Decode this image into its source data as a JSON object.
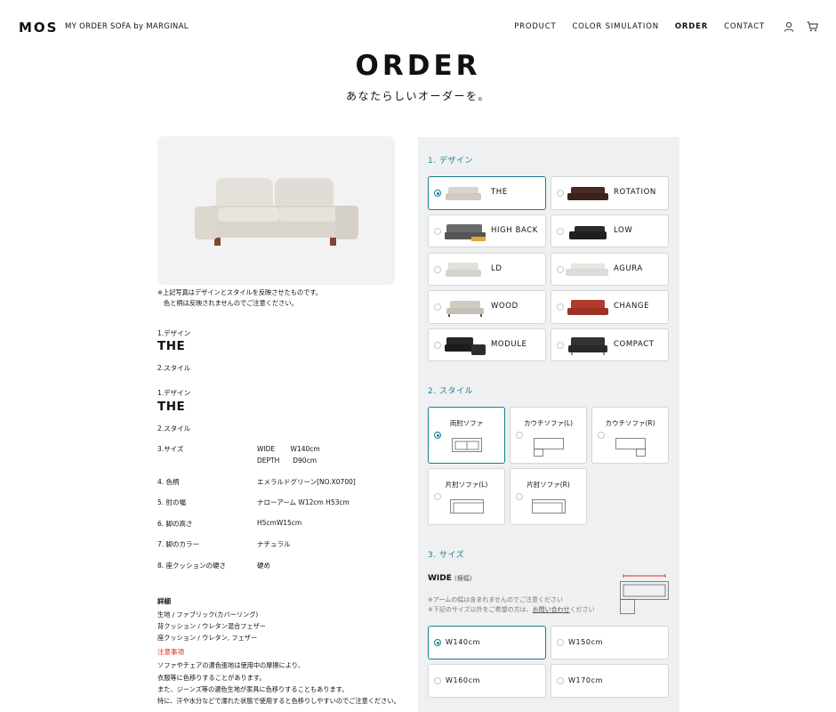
{
  "header": {
    "logo": "MOS",
    "tagline": "MY ORDER SOFA by MARGINAL",
    "nav": [
      {
        "label": "PRODUCT",
        "active": false
      },
      {
        "label": "COLOR SIMULATION",
        "active": false
      },
      {
        "label": "ORDER",
        "active": true
      },
      {
        "label": "CONTACT",
        "active": false
      }
    ],
    "icons": [
      "user-icon",
      "cart-icon"
    ]
  },
  "page": {
    "title": "ORDER",
    "subtitle": "あなたらしいオーダーを。"
  },
  "left": {
    "photo_note": [
      "※上記写真はデザインとスタイルを反映させたものです。",
      "色と柄は反映されませんのでご注意ください。"
    ],
    "summary_a": {
      "design_label": "1.デザイン",
      "design_value": "THE",
      "style_label": "2.スタイル"
    },
    "summary_b": {
      "design_label": "1.デザイン",
      "design_value": "THE",
      "style_label": "2.スタイル"
    },
    "specs": [
      {
        "label": "3.サイズ",
        "value": "WIDE　　 W140cm",
        "value2": "DEPTH　　D90cm"
      },
      {
        "label": "4. 色柄",
        "value": "エメラルドグリーン[NO.X0700]"
      },
      {
        "label": "5. 肘の幅",
        "value": "ナローアーム W12cm H53cm"
      },
      {
        "label": "6. 脚の高さ",
        "value": "H5cmW15cm"
      },
      {
        "label": "7. 脚のカラー",
        "value": "ナチュラル"
      },
      {
        "label": "8. 座クッションの硬さ",
        "value": "硬め"
      }
    ],
    "details_title": "詳細",
    "details": [
      "生地 / ファブリック(カバーリング)",
      "背クッション / ウレタン混合フェザー",
      "座クッション / ウレタン, フェザー"
    ],
    "caution_title": "注意事項",
    "caution": [
      "ソファやチェアの濃色張地は使用中の摩擦により、",
      "衣服等に色移りすることがあります。",
      "また、ジーンズ等の濃色生地が家具に色移りすることもあります。",
      "特に、汗や水分などで濡れた状態で使用すると色移りしやすいのでご注意ください。"
    ]
  },
  "design": {
    "title": "1. デザイン",
    "options": [
      {
        "label": "THE",
        "selected": true,
        "color": "#d9d5ce"
      },
      {
        "label": "ROTATION",
        "selected": false,
        "color": "#4a2a24"
      },
      {
        "label": "HIGH BACK",
        "selected": false,
        "color": "#6a6a6a"
      },
      {
        "label": "LOW",
        "selected": false,
        "color": "#2a2a2a"
      },
      {
        "label": "LD",
        "selected": false,
        "color": "#e2e0dc"
      },
      {
        "label": "AGURA",
        "selected": false,
        "color": "#e8e6e2"
      },
      {
        "label": "WOOD",
        "selected": false,
        "color": "#cfcac2"
      },
      {
        "label": "CHANGE",
        "selected": false,
        "color": "#b13a2c"
      },
      {
        "label": "MODULE",
        "selected": false,
        "color": "#262626"
      },
      {
        "label": "COMPACT",
        "selected": false,
        "color": "#333333"
      }
    ]
  },
  "style": {
    "title": "2. スタイル",
    "options": [
      {
        "label": "両肘ソファ",
        "selected": true
      },
      {
        "label": "カウチソファ(L)",
        "selected": false
      },
      {
        "label": "カウチソファ(R)",
        "selected": false
      },
      {
        "label": "片肘ソファ(L)",
        "selected": false
      },
      {
        "label": "片肘ソファ(R)",
        "selected": false
      }
    ]
  },
  "size": {
    "title": "3. サイズ",
    "wide_label": "WIDE",
    "wide_sub": "(横幅)",
    "note1": "※アームの幅は含まれませんのでご注意ください",
    "note2_pre": "※下記のサイズ以外をご希望の方は、",
    "note2_link": "お問い合わせ",
    "note2_post": "ください",
    "options": [
      {
        "label": "W140cm",
        "selected": true
      },
      {
        "label": "W150cm",
        "selected": false
      },
      {
        "label": "W160cm",
        "selected": false
      },
      {
        "label": "W170cm",
        "selected": false
      }
    ]
  },
  "colors": {
    "accent": "#167f93",
    "panel": "#eff0f1",
    "caution": "#d9302b"
  }
}
